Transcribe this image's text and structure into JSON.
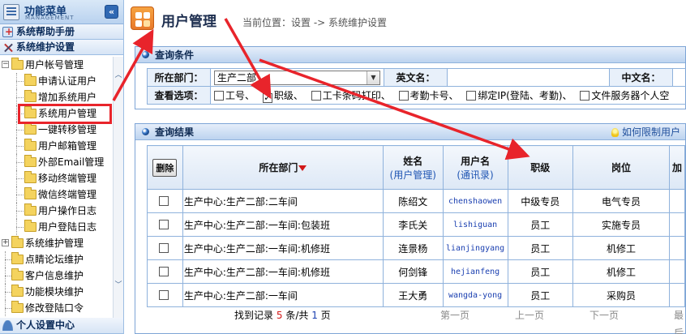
{
  "sidebar": {
    "title": "功能菜单",
    "subtitle": "MANAGEMENT",
    "collapse_glyph": "«",
    "sections": [
      {
        "label": "系统帮助手册",
        "icon": "help-book-icon"
      },
      {
        "label": "系统维护设置",
        "icon": "tools-icon"
      }
    ],
    "tree": [
      {
        "label": "用户帐号管理",
        "level": 0,
        "expander": "−"
      },
      {
        "label": "申请认证用户",
        "level": 1
      },
      {
        "label": "增加系统用户",
        "level": 1
      },
      {
        "label": "系统用户管理",
        "level": 1,
        "highlighted": true
      },
      {
        "label": "一键转移管理",
        "level": 1
      },
      {
        "label": "用户邮箱管理",
        "level": 1
      },
      {
        "label": "外部Email管理",
        "level": 1
      },
      {
        "label": "移动终端管理",
        "level": 1
      },
      {
        "label": "微信终端管理",
        "level": 1
      },
      {
        "label": "用户操作日志",
        "level": 1
      },
      {
        "label": "用户登陆日志",
        "level": 1
      },
      {
        "label": "系统维护管理",
        "level": 0,
        "expander": "+"
      },
      {
        "label": "点睛论坛维护",
        "level": 2
      },
      {
        "label": "客户信息维护",
        "level": 2
      },
      {
        "label": "功能模块维护",
        "level": 2
      },
      {
        "label": "修改登陆口令",
        "level": 2
      }
    ],
    "bottom_section": {
      "label": "个人设置中心",
      "icon": "user-icon"
    }
  },
  "header": {
    "title": "用户管理",
    "breadcrumb": "当前位置：设置 -> 系统维护设置"
  },
  "query": {
    "panel_title": "查询条件",
    "dept_label": "所在部门：",
    "dept_value": "生产二部",
    "english_label": "英文名：",
    "english_value": "",
    "chinese_label": "中文名：",
    "chinese_value": "",
    "view_label": "查看选项：",
    "options": [
      {
        "label": "工号、",
        "checked": false
      },
      {
        "label": "职级、",
        "checked": true
      },
      {
        "label": "工卡条码打印、",
        "checked": false
      },
      {
        "label": "考勤卡号、",
        "checked": false
      },
      {
        "label": "绑定IP(登陆、考勤)、",
        "checked": false
      },
      {
        "label": "文件服务器个人空",
        "checked": false
      }
    ]
  },
  "result": {
    "panel_title": "查询结果",
    "hint": "如何限制用户",
    "delete_label": "删除",
    "columns": {
      "dept": "所在部门",
      "name": "姓名",
      "name_sub": "(用户管理)",
      "username": "用户名",
      "username_sub": "(通讯录)",
      "grade": "职级",
      "post": "岗位",
      "more": "加"
    },
    "rows": [
      {
        "dept": "生产中心:生产二部:二车间",
        "name": "陈绍文",
        "username": "chenshaowen",
        "grade": "中级专员",
        "post": "电气专员"
      },
      {
        "dept": "生产中心:生产二部:一车间:包装班",
        "name": "李氏关",
        "username": "lishiguan",
        "grade": "员工",
        "post": "实施专员"
      },
      {
        "dept": "生产中心:生产二部:一车间:机修班",
        "name": "连景杨",
        "username": "lianjingyang",
        "grade": "员工",
        "post": "机修工"
      },
      {
        "dept": "生产中心:生产二部:一车间:机修班",
        "name": "何剑锋",
        "username": "hejianfeng",
        "grade": "员工",
        "post": "机修工"
      },
      {
        "dept": "生产中心:生产二部:一车间",
        "name": "王大勇",
        "username": "wangda-yong",
        "grade": "员工",
        "post": "采购员"
      }
    ],
    "pager": {
      "prefix": "找到记录",
      "count": "5",
      "mid": "条/共",
      "pages": "1",
      "suffix": "页",
      "first": "第一页",
      "prev": "上一页",
      "next": "下一页",
      "last": "最后"
    }
  },
  "colors": {
    "accent": "#2f68b3",
    "highlight_red": "#e8242b",
    "border_blue": "#8fb2dc"
  }
}
